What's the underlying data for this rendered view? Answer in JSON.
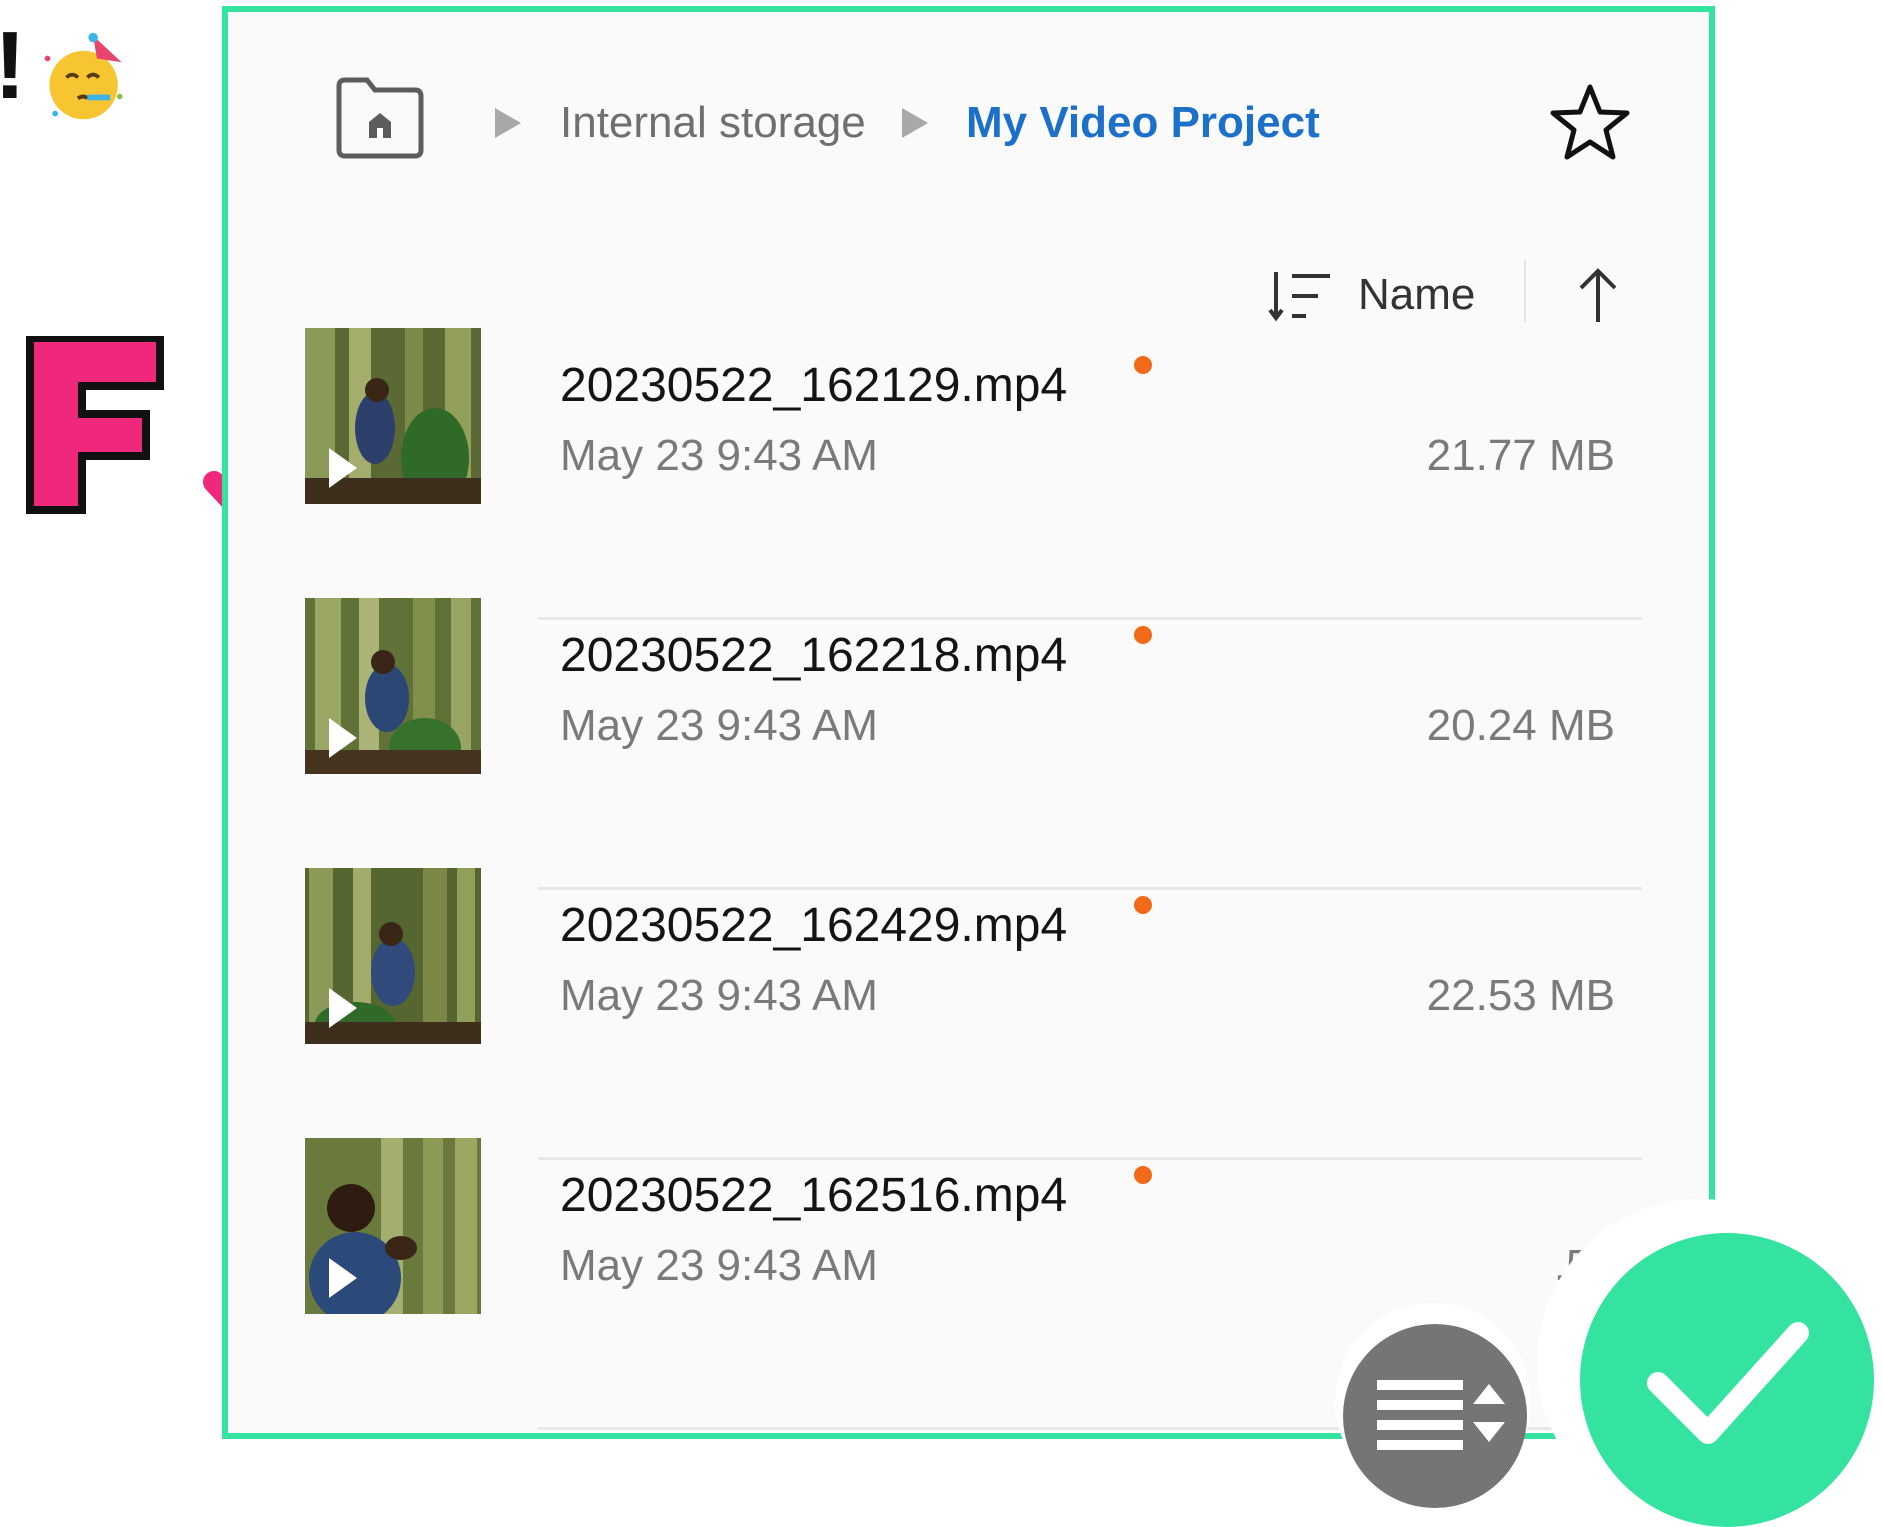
{
  "decorations": {
    "exclaim": "!",
    "letter": "F",
    "emoji_icon": "party-face-icon",
    "arrow_color": "#f0287c",
    "accent_green": "#33e39f"
  },
  "breadcrumb": {
    "home_icon": "home-folder-icon",
    "items": [
      "Internal storage",
      "My Video Project"
    ],
    "current_color": "#1d70c9"
  },
  "toolbar": {
    "favorite_icon": "star-outline-icon",
    "sort_icon": "sort-lines-icon",
    "sort_by": "Name",
    "sort_direction_icon": "arrow-up-icon"
  },
  "files": [
    {
      "name": "20230522_162129.mp4",
      "date": "May 23 9:43 AM",
      "size": "21.77 MB",
      "new_indicator_color": "#f06a18"
    },
    {
      "name": "20230522_162218.mp4",
      "date": "May 23 9:43 AM",
      "size": "20.24 MB",
      "new_indicator_color": "#f06a18"
    },
    {
      "name": "20230522_162429.mp4",
      "date": "May 23 9:43 AM",
      "size": "22.53 MB",
      "new_indicator_color": "#f06a18"
    },
    {
      "name": "20230522_162516.mp4",
      "date": "May 23 9:43 AM",
      "size": ".56",
      "new_indicator_color": "#f06a18"
    }
  ],
  "overlays": {
    "sort_button_icon": "sort-list-icon",
    "confirm_icon": "checkmark-icon"
  }
}
